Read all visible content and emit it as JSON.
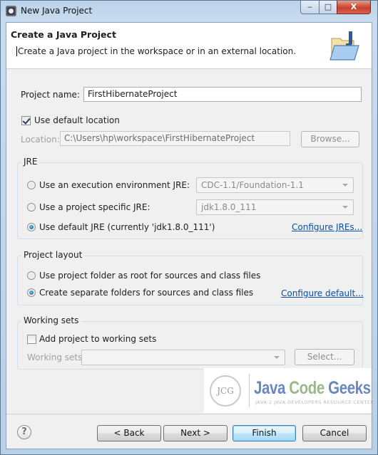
{
  "window": {
    "title": "New Java Project",
    "controls": {
      "minimize": "‒",
      "maximize": "□",
      "close": "X"
    }
  },
  "header": {
    "title": "Create a Java Project",
    "description": "Create a Java project in the workspace or in an external location.",
    "icon": "new-java-project-folder-icon"
  },
  "project": {
    "name_label": "Project name:",
    "name_value": "FirstHibernateProject",
    "use_default_location_label": "Use default location",
    "use_default_location_checked": true,
    "location_label": "Location:",
    "location_value": "C:\\Users\\hp\\workspace\\FirstHibernateProject",
    "browse_label": "Browse..."
  },
  "jre": {
    "group_title": "JRE",
    "options": [
      {
        "label": "Use an execution environment JRE:",
        "selected": false,
        "combo_value": "CDC-1.1/Foundation-1.1"
      },
      {
        "label": "Use a project specific JRE:",
        "selected": false,
        "combo_value": "jdk1.8.0_111"
      },
      {
        "label": "Use default JRE (currently 'jdk1.8.0_111')",
        "selected": true
      }
    ],
    "configure_link": "Configure JREs..."
  },
  "layout": {
    "group_title": "Project layout",
    "options": [
      {
        "label": "Use project folder as root for sources and class files",
        "selected": false
      },
      {
        "label": "Create separate folders for sources and class files",
        "selected": true
      }
    ],
    "configure_link": "Configure default..."
  },
  "working_sets": {
    "group_title": "Working sets",
    "add_label": "Add project to working sets",
    "add_checked": false,
    "sets_label": "Working sets:",
    "sets_value": "",
    "select_label": "Select..."
  },
  "watermark": {
    "logo_text": "JCG",
    "title_java": "Java",
    "title_code": "Code",
    "title_geeks": "Geeks",
    "subtitle": "Java 2 Java Developers Resource Center"
  },
  "footer": {
    "help_icon": "?",
    "back_label": "< Back",
    "next_label": "Next >",
    "finish_label": "Finish",
    "cancel_label": "Cancel"
  }
}
